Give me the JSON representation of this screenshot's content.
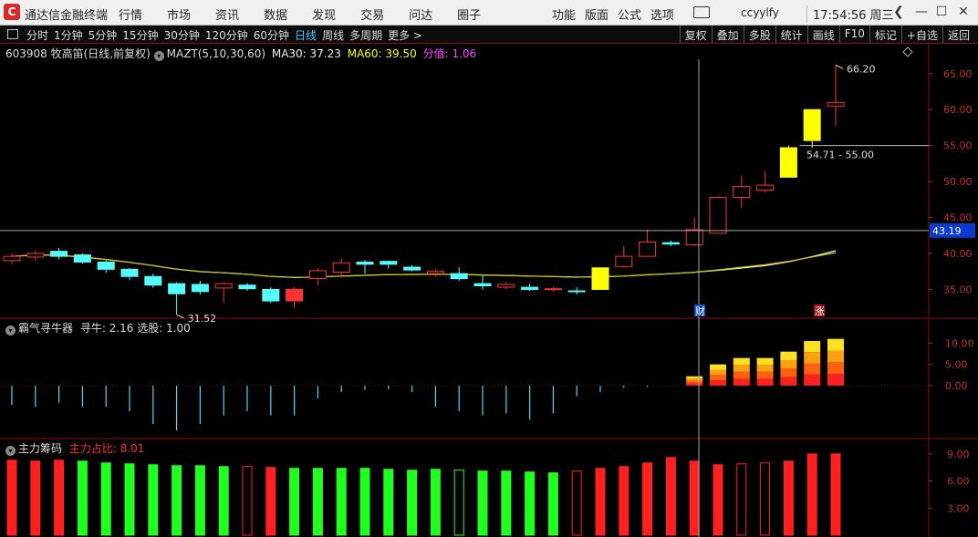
{
  "app": {
    "title": "通达信金融终端",
    "menu": [
      "行情",
      "市场",
      "资讯",
      "数据",
      "发现",
      "交易",
      "问达",
      "圈子"
    ],
    "right_menu": [
      "功能",
      "版面",
      "公式",
      "选项"
    ],
    "user": "ccyylfy",
    "clock": "17:54:56 周三"
  },
  "toolbar": {
    "periods": [
      "分时",
      "1分钟",
      "5分钟",
      "15分钟",
      "30分钟",
      "120分钟",
      "60分钟",
      "日线",
      "周线",
      "多周期",
      "更多 >"
    ],
    "active_period": "日线",
    "right_tools": [
      "复权",
      "叠加",
      "多股",
      "统计",
      "画线",
      "F10",
      "标记",
      "+自选",
      "返回"
    ]
  },
  "stock_info": {
    "code_name": "603908 牧高笛(日线,前复权)",
    "indicator": "MAZT(5,10,30,60)",
    "ma30": "MA30: 37.23",
    "ma60": "MA60: 39.50",
    "split": "分值: 1.06"
  },
  "panels": {
    "mid_name": "霸气寻牛器",
    "mid_values": "寻牛: 2.16  选股: 1.00",
    "bottom_name": "主力筹码",
    "bottom_values": "主力占比: 8.01"
  },
  "markers": {
    "cai": "财",
    "zhang": "涨"
  },
  "colors": {
    "up": "#ff3232",
    "down": "#54fcfc",
    "special": "#ffff00",
    "ma_white": "#f0f0f0",
    "ma_yellow": "#cccc00",
    "chip_red": "#ff2020",
    "chip_green": "#20ff20"
  },
  "chart_data": [
    {
      "type": "candlestick",
      "y_ticks": [
        "65.00",
        "60.00",
        "55.00",
        "50.00",
        "45.00",
        "40.00",
        "35.00"
      ],
      "ylim": [
        31,
        67
      ],
      "crosshair_value": "43.19",
      "high_label": "66.20",
      "low_label": "31.52",
      "range_label": "54.71 - 55.00",
      "candles": [
        {
          "o": 39.0,
          "c": 39.6,
          "h": 40.0,
          "l": 38.5,
          "k": "up"
        },
        {
          "o": 39.5,
          "c": 40.0,
          "h": 40.4,
          "l": 39.0,
          "k": "up"
        },
        {
          "o": 40.3,
          "c": 39.6,
          "h": 40.8,
          "l": 39.2,
          "k": "down"
        },
        {
          "o": 39.8,
          "c": 38.8,
          "h": 40.0,
          "l": 38.6,
          "k": "down"
        },
        {
          "o": 38.8,
          "c": 37.8,
          "h": 39.0,
          "l": 37.3,
          "k": "down"
        },
        {
          "o": 37.8,
          "c": 36.8,
          "h": 38.0,
          "l": 36.3,
          "k": "down"
        },
        {
          "o": 36.8,
          "c": 35.6,
          "h": 37.2,
          "l": 35.2,
          "k": "down"
        },
        {
          "o": 35.8,
          "c": 34.4,
          "h": 36.0,
          "l": 31.5,
          "k": "down"
        },
        {
          "o": 35.7,
          "c": 34.7,
          "h": 36.2,
          "l": 34.3,
          "k": "down"
        },
        {
          "o": 35.2,
          "c": 35.8,
          "h": 36.0,
          "l": 33.2,
          "k": "up"
        },
        {
          "o": 35.6,
          "c": 35.1,
          "h": 35.9,
          "l": 34.8,
          "k": "down"
        },
        {
          "o": 35.0,
          "c": 33.4,
          "h": 35.3,
          "l": 33.1,
          "k": "down"
        },
        {
          "o": 33.4,
          "c": 35.0,
          "h": 35.3,
          "l": 32.4,
          "k": "up_fill"
        },
        {
          "o": 36.5,
          "c": 37.6,
          "h": 38.0,
          "l": 35.6,
          "k": "up"
        },
        {
          "o": 37.4,
          "c": 38.7,
          "h": 39.3,
          "l": 37.0,
          "k": "up"
        },
        {
          "o": 38.8,
          "c": 38.5,
          "h": 39.1,
          "l": 37.2,
          "k": "down"
        },
        {
          "o": 38.9,
          "c": 38.5,
          "h": 39.0,
          "l": 37.9,
          "k": "down"
        },
        {
          "o": 38.1,
          "c": 37.7,
          "h": 38.4,
          "l": 37.5,
          "k": "down"
        },
        {
          "o": 37.2,
          "c": 37.5,
          "h": 37.8,
          "l": 36.8,
          "k": "up"
        },
        {
          "o": 37.2,
          "c": 36.5,
          "h": 38.1,
          "l": 36.2,
          "k": "down"
        },
        {
          "o": 35.8,
          "c": 35.5,
          "h": 37.0,
          "l": 35.0,
          "k": "down"
        },
        {
          "o": 35.3,
          "c": 35.7,
          "h": 36.0,
          "l": 35.0,
          "k": "up"
        },
        {
          "o": 35.3,
          "c": 35.0,
          "h": 35.8,
          "l": 34.8,
          "k": "down"
        },
        {
          "o": 35.0,
          "c": 35.1,
          "h": 35.3,
          "l": 34.7,
          "k": "up"
        },
        {
          "o": 34.8,
          "c": 34.7,
          "h": 35.3,
          "l": 34.3,
          "k": "down"
        },
        {
          "o": 35.0,
          "c": 38.0,
          "h": 38.0,
          "l": 35.0,
          "k": "special"
        },
        {
          "o": 38.2,
          "c": 39.6,
          "h": 41.0,
          "l": 38.0,
          "k": "up"
        },
        {
          "o": 39.6,
          "c": 41.6,
          "h": 43.3,
          "l": 39.5,
          "k": "up"
        },
        {
          "o": 41.3,
          "c": 41.5,
          "h": 41.8,
          "l": 41.0,
          "k": "down"
        },
        {
          "o": 41.2,
          "c": 43.3,
          "h": 45.0,
          "l": 41.0,
          "k": "up"
        },
        {
          "o": 42.8,
          "c": 47.8,
          "h": 48.0,
          "l": 42.8,
          "k": "up"
        },
        {
          "o": 47.8,
          "c": 49.3,
          "h": 50.8,
          "l": 46.3,
          "k": "up"
        },
        {
          "o": 48.8,
          "c": 49.5,
          "h": 51.5,
          "l": 48.5,
          "k": "up"
        },
        {
          "o": 50.6,
          "c": 54.7,
          "h": 55.0,
          "l": 50.6,
          "k": "special"
        },
        {
          "o": 55.7,
          "c": 60.0,
          "h": 60.0,
          "l": 54.7,
          "k": "special"
        },
        {
          "o": 60.5,
          "c": 61.0,
          "h": 66.2,
          "l": 57.8,
          "k": "up"
        }
      ]
    },
    {
      "type": "bar",
      "name": "寻牛",
      "y_ticks": [
        "10.00",
        "5.00",
        "0.00"
      ],
      "ylim": [
        -12,
        12
      ],
      "values": [
        -4.5,
        -5,
        -4,
        -5,
        -5,
        -6,
        -9,
        -10.5,
        -9,
        -7,
        -6,
        -7,
        -7,
        -3,
        -1.5,
        -1,
        -0.8,
        -1.5,
        -5,
        -6,
        -7,
        -6.5,
        -8,
        -6.5,
        -2.5,
        -1.5,
        -0.5,
        -0.3,
        -0.1,
        2.2,
        5,
        6.5,
        6.5,
        8,
        10.5,
        11
      ]
    },
    {
      "type": "bar",
      "name": "主力占比",
      "y_ticks": [
        "9.00",
        "6.00",
        "3.00"
      ],
      "ylim": [
        0,
        10.5
      ],
      "values": [
        8.3,
        8.2,
        8.3,
        8.2,
        8.0,
        7.9,
        7.8,
        7.7,
        7.7,
        7.6,
        7.6,
        7.5,
        7.4,
        7.4,
        7.4,
        7.4,
        7.3,
        7.2,
        7.3,
        7.2,
        7.1,
        7.1,
        7.0,
        6.9,
        7.1,
        7.4,
        7.6,
        8.0,
        8.6,
        8.2,
        7.8,
        7.9,
        8.0,
        8.2,
        9.0,
        9.0
      ],
      "colors": [
        "r",
        "r",
        "r",
        "g",
        "g",
        "g",
        "g",
        "g",
        "g",
        "g",
        "r",
        "r",
        "g",
        "g",
        "g",
        "g",
        "g",
        "g",
        "g",
        "g",
        "g",
        "g",
        "g",
        "g",
        "r",
        "r",
        "r",
        "r",
        "r",
        "r",
        "r",
        "r",
        "r",
        "r",
        "r",
        "r"
      ],
      "hollow": [
        0,
        0,
        0,
        0,
        0,
        0,
        0,
        0,
        0,
        0,
        1,
        0,
        0,
        0,
        0,
        0,
        0,
        0,
        0,
        1,
        0,
        0,
        0,
        0,
        1,
        0,
        0,
        0,
        0,
        0,
        0,
        1,
        1,
        0,
        0,
        0
      ]
    }
  ]
}
